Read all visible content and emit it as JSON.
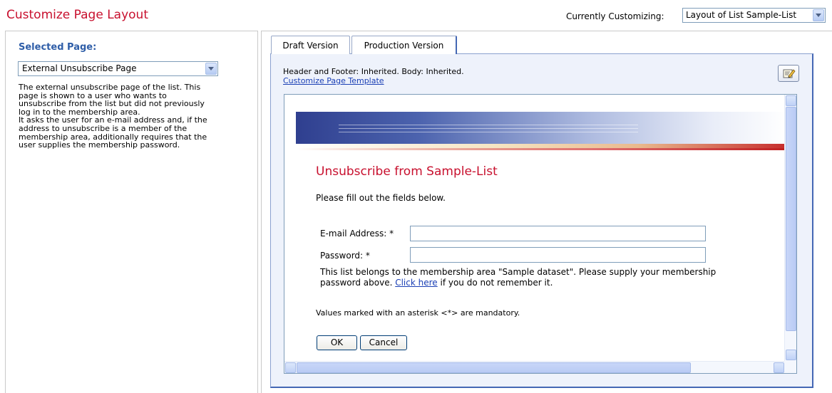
{
  "header": {
    "title": "Customize Page Layout",
    "customizing_label": "Currently Customizing:",
    "customizing_value": "Layout of List Sample-List"
  },
  "left": {
    "heading": "Selected Page:",
    "selected_page": "External Unsubscribe Page",
    "description": "The external unsubscribe page of the list. This\npage is shown to a user who wants to\nunsubscribe from the list but did not previously\nlog in to the membership area.\nIt asks the user for an e-mail address and, if the\naddress to unsubscribe is a member of the\nmembership area, additionally requires that the\nuser supplies the membership password."
  },
  "tabs": [
    {
      "label": "Draft Version"
    },
    {
      "label": "Production Version"
    }
  ],
  "panel": {
    "header_footer_text": "Header and Footer: Inherited. Body: Inherited.",
    "template_link": "Customize Page Template"
  },
  "preview": {
    "title": "Unsubscribe from Sample-List",
    "intro": "Please fill out the fields below.",
    "email_label": "E-mail Address: *",
    "password_label": "Password: *",
    "email_value": "",
    "password_value": "",
    "membership_note_before": "This list belongs to the membership area \"Sample dataset\". Please supply your membership password above. ",
    "membership_note_link": "Click here",
    "membership_note_after": " if you do not remember it.",
    "mandatory_note": "Values marked with an asterisk <*> are mandatory.",
    "ok_label": "OK",
    "cancel_label": "Cancel"
  },
  "icons": {
    "edit": "edit-pencil-icon"
  }
}
